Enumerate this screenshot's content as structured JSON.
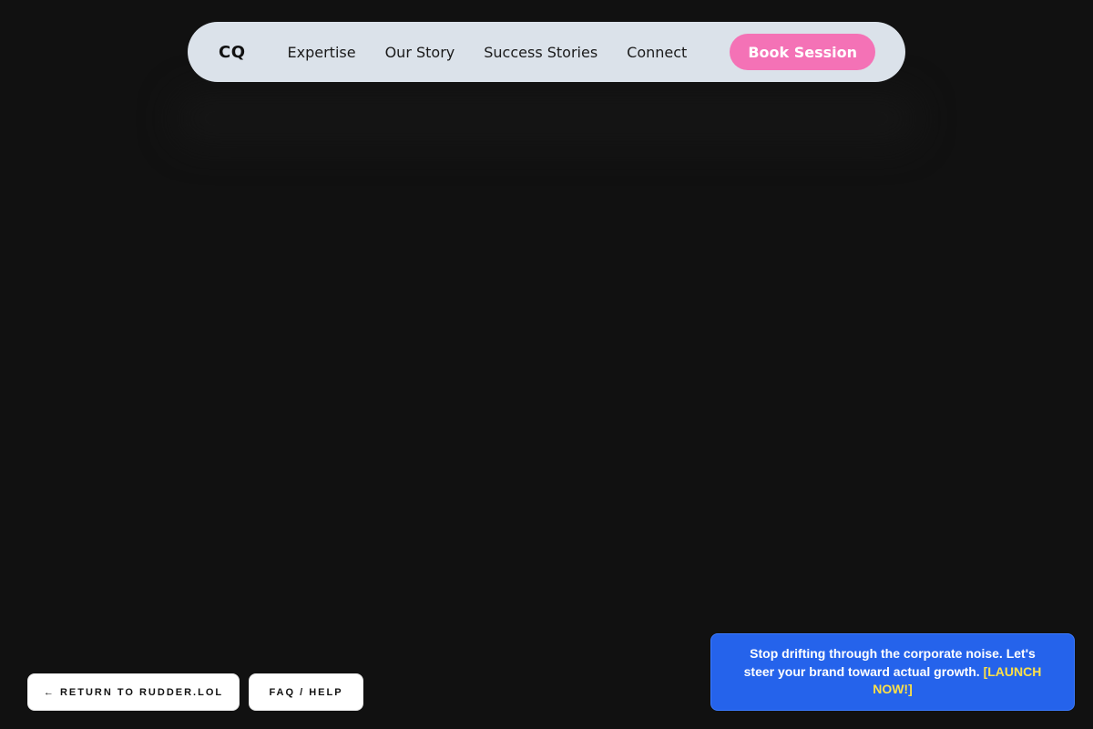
{
  "navbar": {
    "brand": "CQ",
    "links": [
      {
        "label": "Expertise"
      },
      {
        "label": "Our Story"
      },
      {
        "label": "Success Stories"
      },
      {
        "label": "Connect"
      }
    ],
    "cta_label": "Book Session"
  },
  "footer": {
    "return_label": "← RETURN TO RUDDER.LOL",
    "faq_label": "FAQ / HELP"
  },
  "promo": {
    "message": "Stop drifting through the corporate noise. Let's steer your brand toward actual growth.",
    "link_label": "[LAUNCH NOW!]"
  },
  "colors": {
    "background": "#111111",
    "navbar": "#dbe2ea",
    "cta": "#f472b6",
    "promo": "#2563eb",
    "promo_link": "#fde047"
  }
}
